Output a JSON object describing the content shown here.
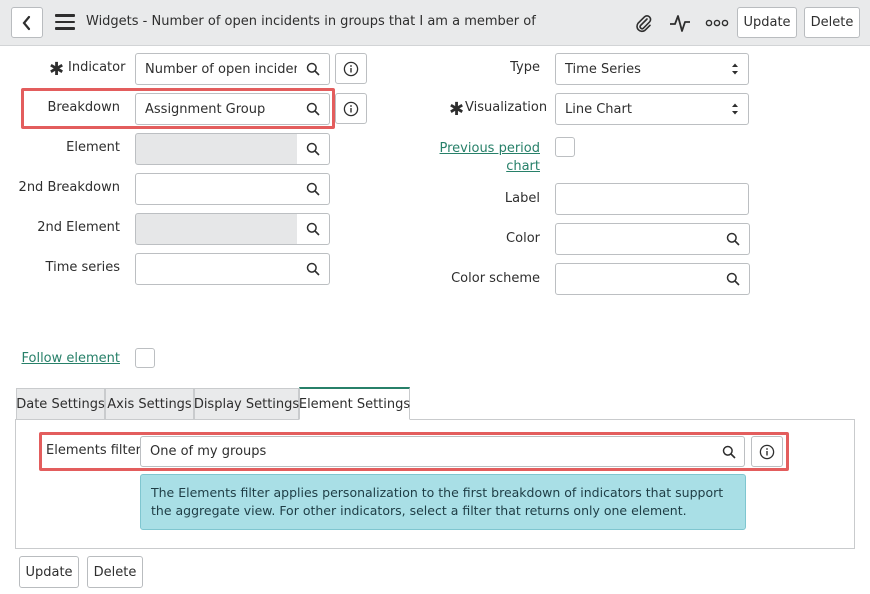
{
  "header": {
    "title": "Widgets - Number of open incidents in groups that I am a member of",
    "update_label": "Update",
    "delete_label": "Delete"
  },
  "form": {
    "indicator": {
      "label": "Indicator",
      "value": "Number of open incidents"
    },
    "breakdown": {
      "label": "Breakdown",
      "value": "Assignment Group"
    },
    "element": {
      "label": "Element",
      "value": ""
    },
    "breakdown2": {
      "label": "2nd Breakdown",
      "value": ""
    },
    "element2": {
      "label": "2nd Element",
      "value": ""
    },
    "time_series": {
      "label": "Time series",
      "value": ""
    },
    "follow_element": {
      "label": "Follow element"
    },
    "type": {
      "label": "Type",
      "value": "Time Series"
    },
    "visualization": {
      "label": "Visualization",
      "value": "Line Chart"
    },
    "previous_period": {
      "label_line1": "Previous period",
      "label_line2": "chart"
    },
    "label_field": {
      "label": "Label",
      "value": ""
    },
    "color": {
      "label": "Color",
      "value": ""
    },
    "color_scheme": {
      "label": "Color scheme",
      "value": ""
    }
  },
  "tabs": [
    {
      "label": "Date Settings"
    },
    {
      "label": "Axis Settings"
    },
    {
      "label": "Display Settings"
    },
    {
      "label": "Element Settings"
    }
  ],
  "element_settings": {
    "filter_label": "Elements filter",
    "filter_value": "One of my groups",
    "info_text": "The Elements filter applies personalization to the first breakdown of indicators that support the aggregate view. For other indicators, select a filter that returns only one element."
  },
  "footer": {
    "update_label": "Update",
    "delete_label": "Delete"
  },
  "colors": {
    "accent": "#278069",
    "highlight": "#e35d5d",
    "info_bg": "#a9dfe6"
  }
}
